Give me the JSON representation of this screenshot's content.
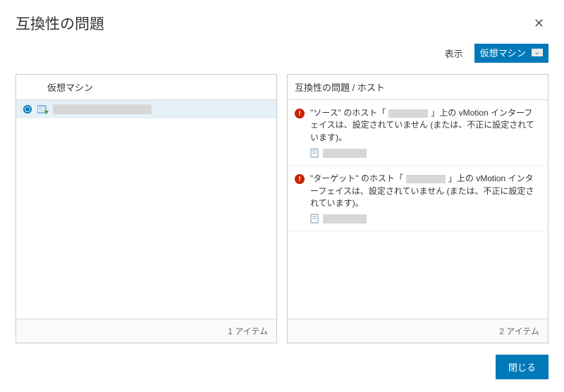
{
  "dialog": {
    "title": "互換性の問題",
    "closeLabel": "閉じる"
  },
  "filter": {
    "showLabel": "表示",
    "selected": "仮想マシン"
  },
  "leftPanel": {
    "header": "仮想マシン",
    "footer": "1 アイテム"
  },
  "rightPanel": {
    "header": "互換性の問題 / ホスト",
    "footer": "2 アイテム"
  },
  "issues": [
    {
      "prefix": "\"ソース\" のホスト「",
      "suffix": "」上の vMotion インターフェイスは、設定されていません (または、不正に設定されています)。"
    },
    {
      "prefix": "\"ターゲット\" のホスト「",
      "suffix": "」上の vMotion インターフェイスは、設定されていません (または、不正に設定されています)。"
    }
  ]
}
